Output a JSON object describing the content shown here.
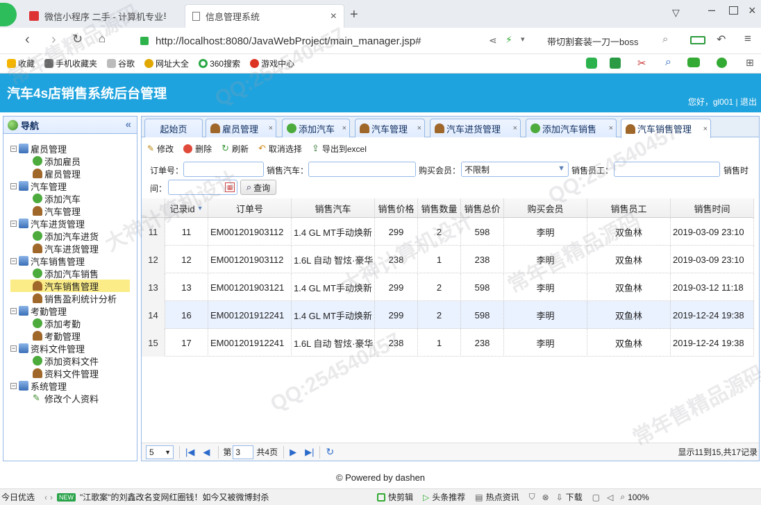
{
  "browser": {
    "tabs": [
      {
        "label": "微信小程序 二手 - 计算机专业毕"
      },
      {
        "label": "信息管理系统"
      }
    ],
    "url": "http://localhost:8080/JavaWebProject/main_manager.jsp#",
    "url_host": "localhost",
    "search_text": "带切割套装一刀一boss",
    "bookmarks": [
      "收藏",
      "手机收藏夹",
      "谷歌",
      "网址大全",
      "360搜索",
      "游戏中心"
    ]
  },
  "app": {
    "title": "汽车4s店销售系统后台管理",
    "welcome": "您好，gl001 | 退出",
    "footer": "© Powered by dashen"
  },
  "sidebar": {
    "title": "导航",
    "groups": [
      {
        "label": "雇员管理",
        "items": [
          "添加雇员",
          "雇员管理"
        ]
      },
      {
        "label": "汽车管理",
        "items": [
          "添加汽车",
          "汽车管理"
        ]
      },
      {
        "label": "汽车进货管理",
        "items": [
          "添加汽车进货",
          "汽车进货管理"
        ]
      },
      {
        "label": "汽车销售管理",
        "items": [
          "添加汽车销售",
          "汽车销售管理",
          "销售盈利统计分析"
        ]
      },
      {
        "label": "考勤管理",
        "items": [
          "添加考勤",
          "考勤管理"
        ]
      },
      {
        "label": "资料文件管理",
        "items": [
          "添加资料文件",
          "资料文件管理"
        ]
      },
      {
        "label": "系统管理",
        "items": [
          "修改个人资料"
        ]
      }
    ]
  },
  "main_tabs": [
    "起始页",
    "雇员管理",
    "添加汽车",
    "汽车管理",
    "汽车进货管理",
    "添加汽车销售",
    "汽车销售管理"
  ],
  "toolbar": {
    "edit": "修改",
    "delete": "删除",
    "refresh": "刷新",
    "unselect": "取消选择",
    "export": "导出到excel"
  },
  "filters": {
    "order_no_label": "订单号：",
    "car_label": "销售汽车：",
    "member_label": "购买会员：",
    "member_value": "不限制",
    "employee_label": "销售员工：",
    "time_label_1": "销售时",
    "time_label_2": "间：",
    "query_button": "查询"
  },
  "grid": {
    "columns": [
      "记录id",
      "订单号",
      "销售汽车",
      "销售价格",
      "销售数量",
      "销售总价",
      "购买会员",
      "销售员工",
      "销售时间"
    ],
    "rows": [
      {
        "rownum": "11",
        "id": "11",
        "order": "EM001201903112",
        "car": "1.4 GL MT手动焕新",
        "price": "299",
        "qty": "2",
        "total": "598",
        "member": "李明",
        "employee": "双鱼林",
        "time": "2019-03-09 23:10"
      },
      {
        "rownum": "12",
        "id": "12",
        "order": "EM001201903112",
        "car": "1.6L 自动 智炫·豪华",
        "price": "238",
        "qty": "1",
        "total": "238",
        "member": "李明",
        "employee": "双鱼林",
        "time": "2019-03-09 23:10"
      },
      {
        "rownum": "13",
        "id": "13",
        "order": "EM001201903121",
        "car": "1.4 GL MT手动焕新",
        "price": "299",
        "qty": "2",
        "total": "598",
        "member": "李明",
        "employee": "双鱼林",
        "time": "2019-03-12 11:18"
      },
      {
        "rownum": "14",
        "id": "16",
        "order": "EM001201912241",
        "car": "1.4 GL MT手动焕新",
        "price": "299",
        "qty": "2",
        "total": "598",
        "member": "李明",
        "employee": "双鱼林",
        "time": "2019-12-24 19:38"
      },
      {
        "rownum": "15",
        "id": "17",
        "order": "EM001201912241",
        "car": "1.6L 自动 智炫·豪华",
        "price": "238",
        "qty": "1",
        "total": "238",
        "member": "李明",
        "employee": "双鱼林",
        "time": "2019-12-24 19:38"
      }
    ]
  },
  "pager": {
    "page_size": "5",
    "page_prefix": "第",
    "page_value": "3",
    "page_total": "共4页",
    "summary": "显示11到15,共17记录"
  },
  "statusbar": {
    "left": "今日优选",
    "news_badge": "NEW",
    "news": "\"江歌案\"的刘鑫改名变网红圈钱！如今又被微博封杀",
    "items": [
      "快剪辑",
      "头条推荐",
      "热点资讯"
    ],
    "download": "下载",
    "zoom": "100%"
  },
  "watermarks": [
    "QQ:254540457",
    "常年售精品源码",
    "大神计算机设计"
  ]
}
